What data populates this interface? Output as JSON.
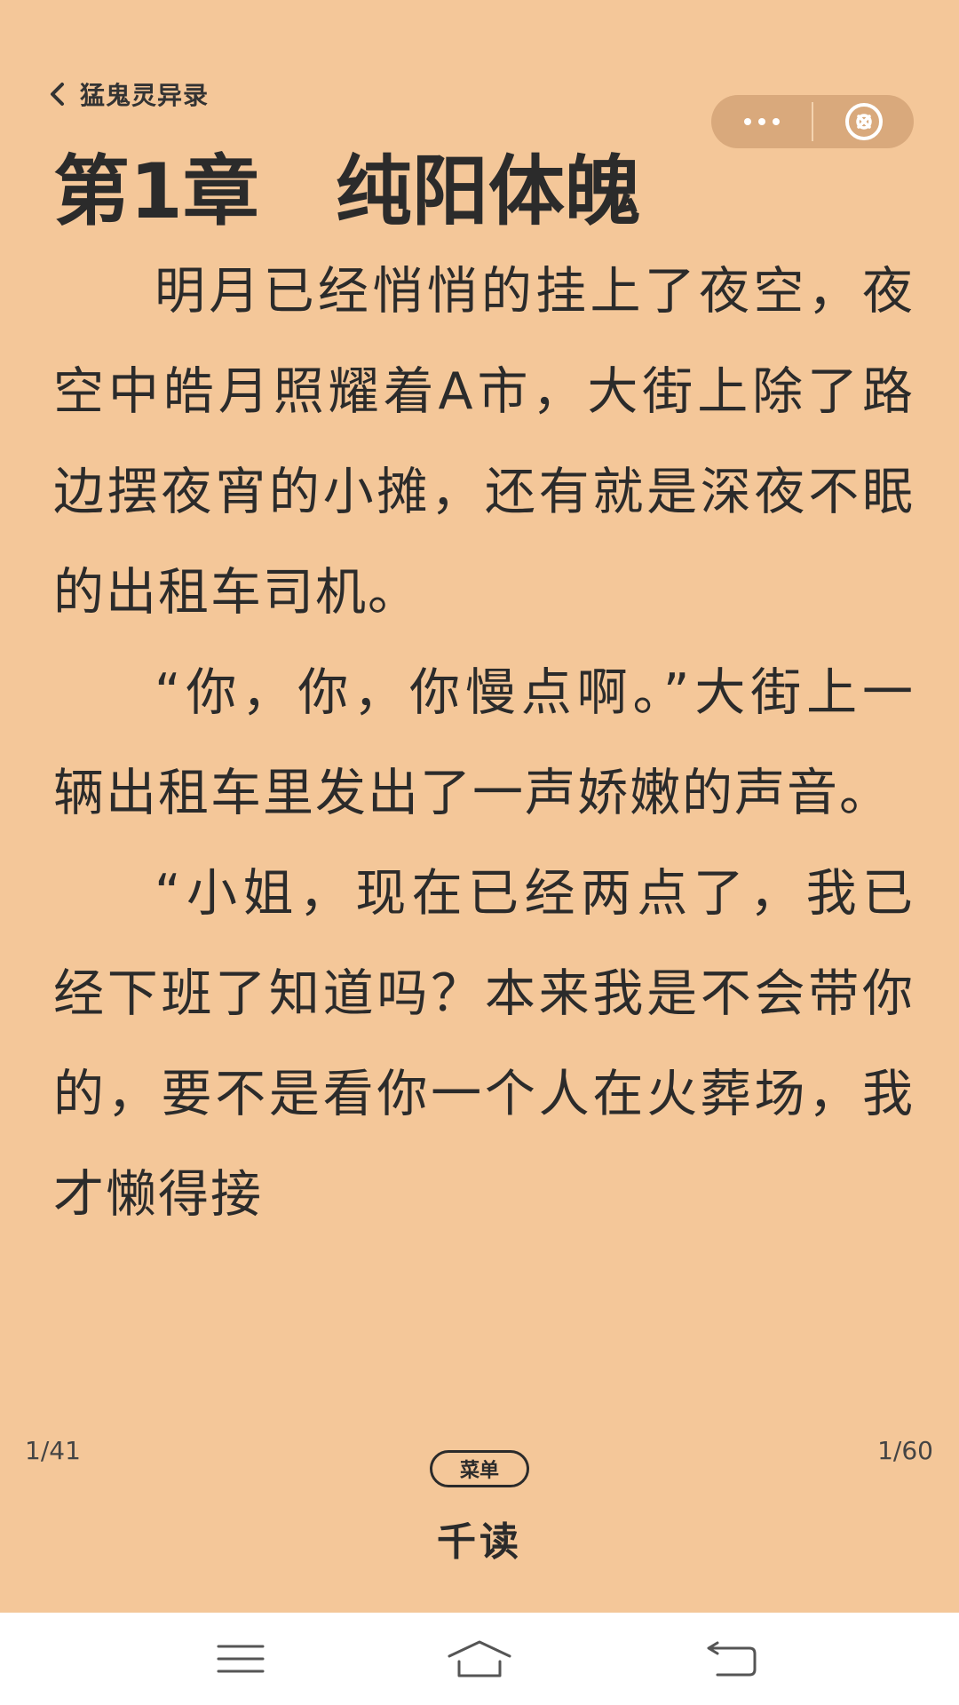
{
  "header": {
    "back_label": "猛鬼灵异录",
    "icons": {
      "back": "chevron-left-icon",
      "more": "more-dots-icon",
      "close": "close-circle-icon"
    }
  },
  "chapter": {
    "title": "第1章　纯阳体魄"
  },
  "content": {
    "paragraphs": [
      "明月已经悄悄的挂上了夜空，夜空中皓月照耀着A市，大街上除了路边摆夜宵的小摊，还有就是深夜不眠的出租车司机。",
      "“你，你，你慢点啊。”大街上一辆出租车里发出了一声娇嫩的声音。",
      "“小姐，现在已经两点了，我已经下班了知道吗？本来我是不会带你的，要不是看你一个人在火葬场，我才懒得接"
    ]
  },
  "footer": {
    "page_left": "1/41",
    "page_right": "1/60",
    "menu_label": "菜单",
    "brand": "千读"
  },
  "system_nav": {
    "icons": [
      "menu-lines-icon",
      "home-icon",
      "back-arrow-icon"
    ]
  },
  "colors": {
    "page_background": "#F4C799",
    "capsule": "#D9A97C",
    "text": "#2b2b2b",
    "nav_background": "#ffffff"
  }
}
